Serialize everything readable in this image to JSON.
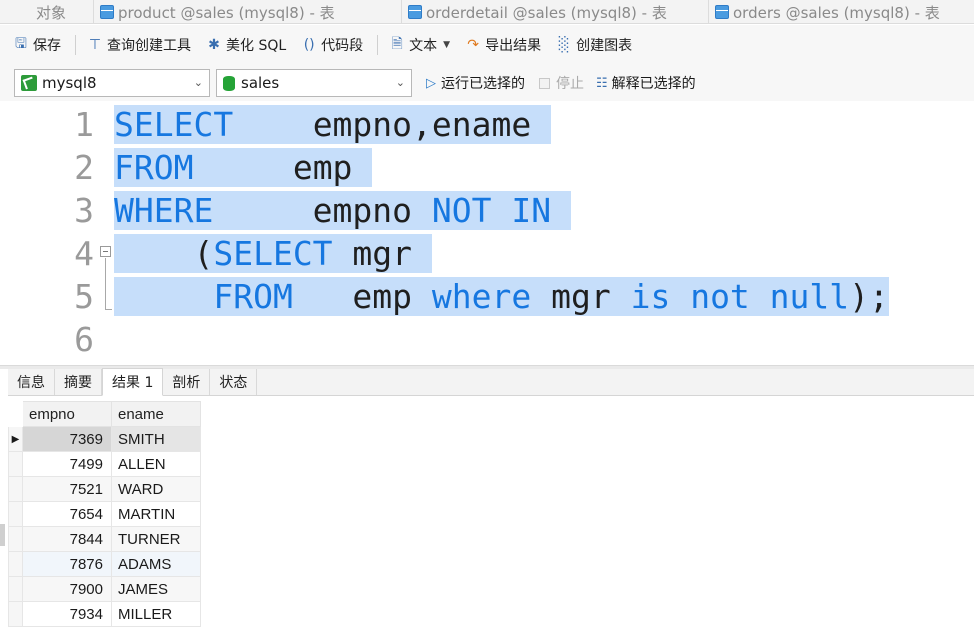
{
  "tabs": [
    {
      "label": "对象"
    },
    {
      "label": "product @sales (mysql8) - 表"
    },
    {
      "label": "orderdetail @sales (mysql8) - 表"
    },
    {
      "label": "orders @sales (mysql8) - 表"
    }
  ],
  "toolbar": {
    "save": "保存",
    "query_builder": "查询创建工具",
    "beautify": "美化 SQL",
    "snippet": "代码段",
    "text": "文本",
    "export": "导出结果",
    "chart": "创建图表"
  },
  "connection": {
    "server": "mysql8",
    "database": "sales",
    "run_selected": "运行已选择的",
    "stop": "停止",
    "explain_selected": "解释已选择的"
  },
  "editor": {
    "line_numbers": [
      "1",
      "2",
      "3",
      "4",
      "5",
      "6"
    ],
    "lines": [
      {
        "kw1": "SELECT",
        "rest": "    empno,ename "
      },
      {
        "kw1": "FROM",
        "rest": "     emp "
      },
      {
        "kw1": "WHERE",
        "rest": "     empno ",
        "kw2": "NOT IN "
      },
      {
        "indent": "    (",
        "kw1": "SELECT",
        "rest": " mgr "
      },
      {
        "indent": "     ",
        "kw1": "FROM",
        "rest": "   emp ",
        "kw2": "where",
        "rest2": " mgr ",
        "kw3": "is not null",
        "rest3": ");"
      },
      {}
    ]
  },
  "result_tabs": [
    "信息",
    "摘要",
    "结果 1",
    "剖析",
    "状态"
  ],
  "grid": {
    "columns": [
      "empno",
      "ename"
    ],
    "rows": [
      {
        "empno": "7369",
        "ename": "SMITH"
      },
      {
        "empno": "7499",
        "ename": "ALLEN"
      },
      {
        "empno": "7521",
        "ename": "WARD"
      },
      {
        "empno": "7654",
        "ename": "MARTIN"
      },
      {
        "empno": "7844",
        "ename": "TURNER"
      },
      {
        "empno": "7876",
        "ename": "ADAMS"
      },
      {
        "empno": "7900",
        "ename": "JAMES"
      },
      {
        "empno": "7934",
        "ename": "MILLER"
      }
    ]
  },
  "colors": {
    "keyword": "#1677e0",
    "selection": "#c6defa",
    "db_icon": "#25a337"
  }
}
